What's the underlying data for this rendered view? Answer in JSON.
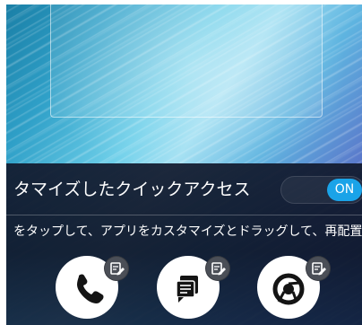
{
  "panel": {
    "title": "タマイズしたクイックアクセス",
    "toggle_label": "ON",
    "subtitle": "をタップして、アプリをカスタマイズとドラッグして、再配置"
  },
  "apps": [
    {
      "name": "phone",
      "icon": "phone-icon"
    },
    {
      "name": "messages",
      "icon": "message-icon"
    },
    {
      "name": "chrome",
      "icon": "chrome-icon"
    }
  ],
  "colors": {
    "toggle_on": "#1aa3e8",
    "panel_bg": "#121a2e",
    "badge_bg": "#4b4f57"
  }
}
